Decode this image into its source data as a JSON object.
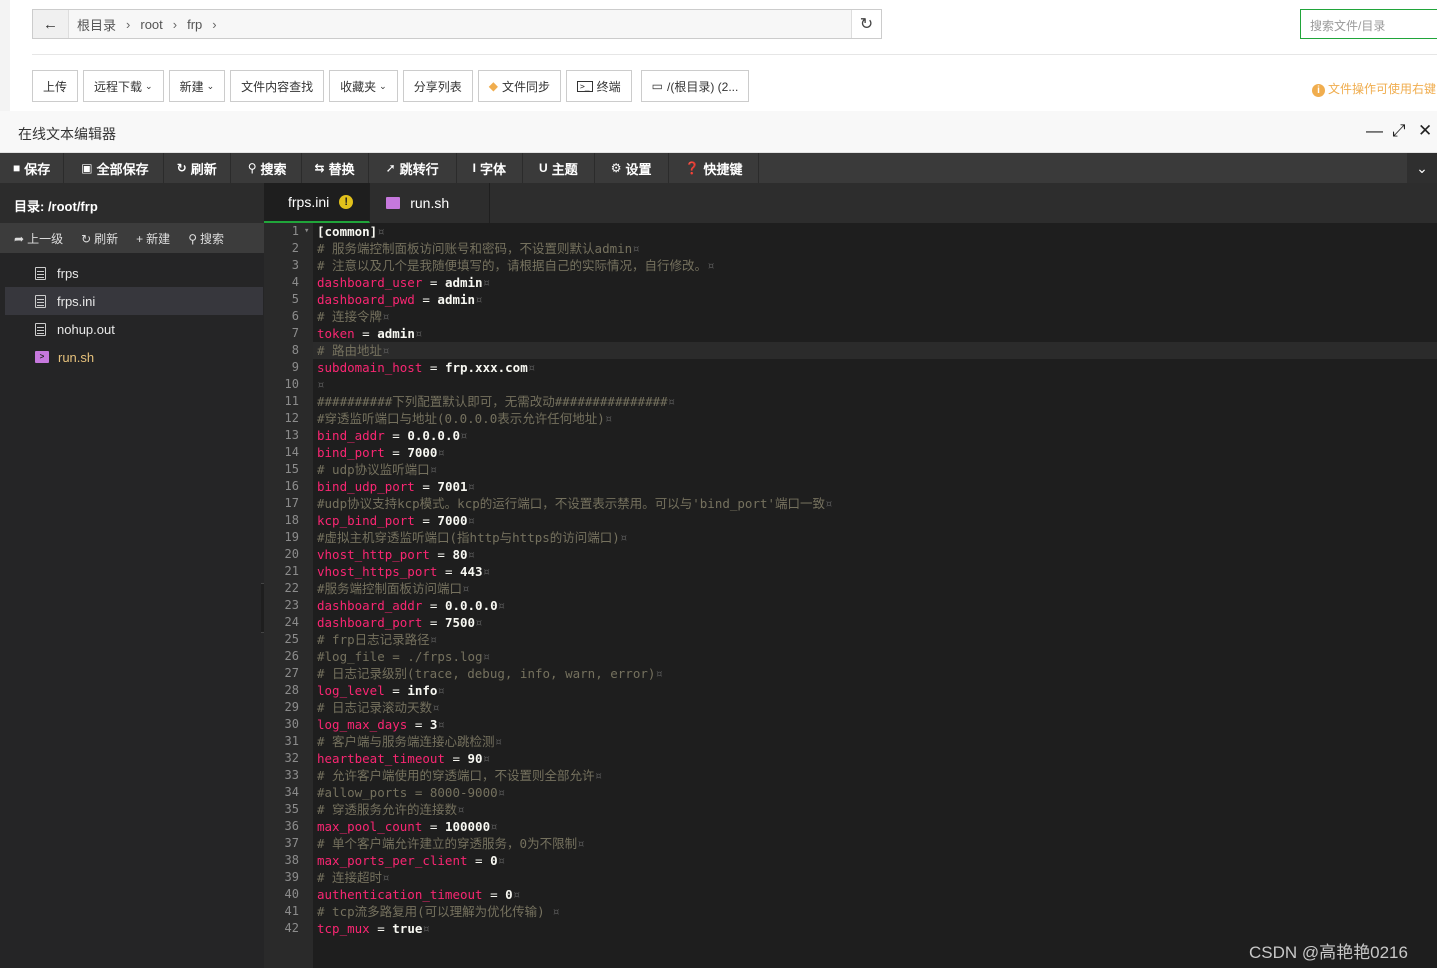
{
  "file_manager": {
    "breadcrumb": [
      "根目录",
      "root",
      "frp"
    ],
    "search_placeholder": "搜索文件/目录",
    "buttons": {
      "upload": "上传",
      "remote_download": "远程下载",
      "new": "新建",
      "content_search": "文件内容查找",
      "favorites": "收藏夹",
      "share_list": "分享列表",
      "file_sync": "文件同步",
      "terminal": "终端",
      "disk": "/(根目录) (2..."
    },
    "tip": "文件操作可使用右键"
  },
  "editor_window": {
    "title": "在线文本编辑器"
  },
  "toolbar": {
    "save": "保存",
    "save_all": "全部保存",
    "refresh": "刷新",
    "search": "搜索",
    "replace": "替换",
    "goto_line": "跳转行",
    "font": "字体",
    "theme": "主题",
    "settings": "设置",
    "shortcuts": "快捷键"
  },
  "sidebar": {
    "directory": "目录: /root/frp",
    "actions": {
      "up": "上一级",
      "refresh": "刷新",
      "new": "新建",
      "search": "搜索"
    },
    "files": [
      {
        "name": "frps",
        "type": "file"
      },
      {
        "name": "frps.ini",
        "type": "file"
      },
      {
        "name": "nohup.out",
        "type": "file"
      },
      {
        "name": "run.sh",
        "type": "shell"
      }
    ]
  },
  "tabs": [
    {
      "name": "frps.ini",
      "badge": "!"
    },
    {
      "name": "run.sh"
    }
  ],
  "code_lines": [
    {
      "n": "1",
      "kind": "section",
      "text": "[common]"
    },
    {
      "n": "2",
      "kind": "comment",
      "text": "# 服务端控制面板访问账号和密码，不设置则默认admin"
    },
    {
      "n": "3",
      "kind": "comment",
      "text": "# 注意以及几个是我随便填写的，请根据自己的实际情况，自行修改。"
    },
    {
      "n": "4",
      "kind": "kv",
      "key": "dashboard_user",
      "val": "admin"
    },
    {
      "n": "5",
      "kind": "kv",
      "key": "dashboard_pwd",
      "val": "admin"
    },
    {
      "n": "6",
      "kind": "comment",
      "text": "# 连接令牌"
    },
    {
      "n": "7",
      "kind": "kv",
      "key": "token",
      "val": "admin"
    },
    {
      "n": "8",
      "kind": "comment",
      "text": "# 路由地址"
    },
    {
      "n": "9",
      "kind": "kv",
      "key": "subdomain_host",
      "val": "frp.xxx.com"
    },
    {
      "n": "10",
      "kind": "empty",
      "text": ""
    },
    {
      "n": "11",
      "kind": "comment",
      "text": "##########下列配置默认即可，无需改动###############"
    },
    {
      "n": "12",
      "kind": "comment",
      "text": "#穿透监听端口与地址(0.0.0.0表示允许任何地址)"
    },
    {
      "n": "13",
      "kind": "kv",
      "key": "bind_addr",
      "val": "0.0.0.0"
    },
    {
      "n": "14",
      "kind": "kv",
      "key": "bind_port",
      "val": "7000"
    },
    {
      "n": "15",
      "kind": "comment",
      "text": "# udp协议监听端口"
    },
    {
      "n": "16",
      "kind": "kv",
      "key": "bind_udp_port",
      "val": "7001"
    },
    {
      "n": "17",
      "kind": "comment",
      "text": "#udp协议支持kcp模式。kcp的运行端口，不设置表示禁用。可以与'bind_port'端口一致"
    },
    {
      "n": "18",
      "kind": "kv",
      "key": "kcp_bind_port",
      "val": "7000"
    },
    {
      "n": "19",
      "kind": "comment",
      "text": "#虚拟主机穿透监听端口(指http与https的访问端口)"
    },
    {
      "n": "20",
      "kind": "kv",
      "key": "vhost_http_port",
      "val": "80"
    },
    {
      "n": "21",
      "kind": "kv",
      "key": "vhost_https_port",
      "val": "443"
    },
    {
      "n": "22",
      "kind": "comment",
      "text": "#服务端控制面板访问端口"
    },
    {
      "n": "23",
      "kind": "kv",
      "key": "dashboard_addr",
      "val": "0.0.0.0"
    },
    {
      "n": "24",
      "kind": "kv",
      "key": "dashboard_port",
      "val": "7500"
    },
    {
      "n": "25",
      "kind": "comment",
      "text": "# frp日志记录路径"
    },
    {
      "n": "26",
      "kind": "comment",
      "text": "#log_file = ./frps.log"
    },
    {
      "n": "27",
      "kind": "comment",
      "text": "# 日志记录级别(trace, debug, info, warn, error)"
    },
    {
      "n": "28",
      "kind": "kv",
      "key": "log_level",
      "val": "info"
    },
    {
      "n": "29",
      "kind": "comment",
      "text": "# 日志记录滚动天数"
    },
    {
      "n": "30",
      "kind": "kv",
      "key": "log_max_days",
      "val": "3"
    },
    {
      "n": "31",
      "kind": "comment",
      "text": "# 客户端与服务端连接心跳检测"
    },
    {
      "n": "32",
      "kind": "kv",
      "key": "heartbeat_timeout",
      "val": "90"
    },
    {
      "n": "33",
      "kind": "comment",
      "text": "# 允许客户端使用的穿透端口，不设置则全部允许"
    },
    {
      "n": "34",
      "kind": "comment",
      "text": "#allow_ports = 8000-9000"
    },
    {
      "n": "35",
      "kind": "comment",
      "text": "# 穿透服务允许的连接数"
    },
    {
      "n": "36",
      "kind": "kv",
      "key": "max_pool_count",
      "val": "100000"
    },
    {
      "n": "37",
      "kind": "comment",
      "text": "# 单个客户端允许建立的穿透服务，0为不限制"
    },
    {
      "n": "38",
      "kind": "kv",
      "key": "max_ports_per_client",
      "val": "0"
    },
    {
      "n": "39",
      "kind": "comment",
      "text": "# 连接超时"
    },
    {
      "n": "40",
      "kind": "kv",
      "key": "authentication_timeout",
      "val": "0"
    },
    {
      "n": "41",
      "kind": "comment",
      "text": "# tcp流多路复用(可以理解为优化传输) "
    },
    {
      "n": "42",
      "kind": "kv",
      "key": "tcp_mux",
      "val": "true"
    }
  ],
  "watermark": "CSDN @高艳艳0216",
  "colors": {
    "accent": "#20a53a",
    "key": "#f92672",
    "comment": "#75715e",
    "warn": "#f0ad4e"
  }
}
